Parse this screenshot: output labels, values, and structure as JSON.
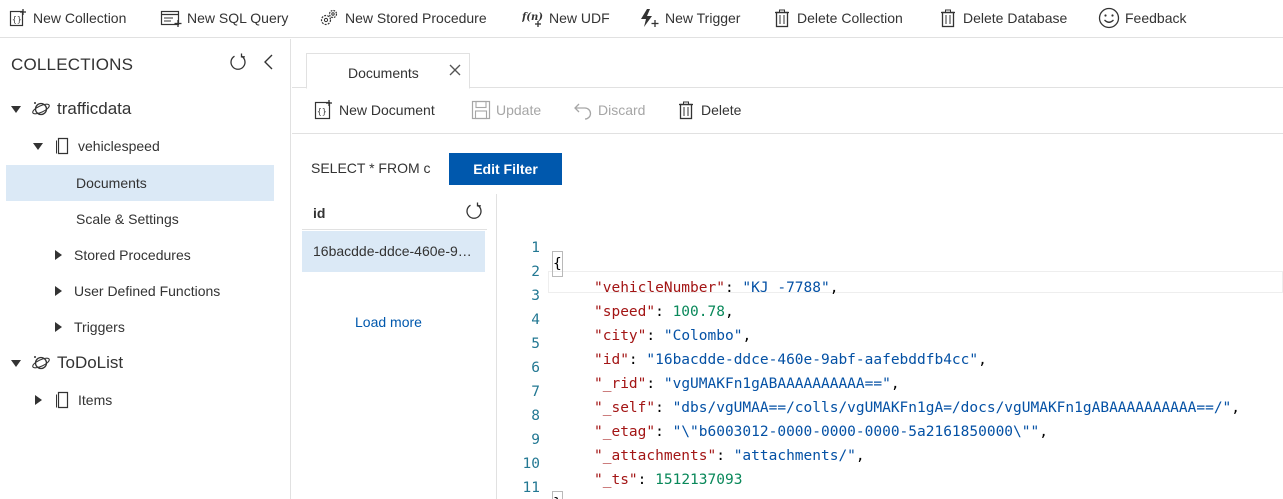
{
  "toolbar": {
    "new_collection": "New Collection",
    "new_sql_query": "New SQL Query",
    "new_stored_procedure": "New Stored Procedure",
    "new_udf": "New UDF",
    "new_trigger": "New Trigger",
    "delete_collection": "Delete Collection",
    "delete_database": "Delete Database",
    "feedback": "Feedback"
  },
  "sidebar": {
    "title": "COLLECTIONS",
    "tree": [
      {
        "label": "trafficdata",
        "level": "database",
        "expanded": true
      },
      {
        "label": "vehiclespeed",
        "level": "collection",
        "expanded": true
      },
      {
        "label": "Documents",
        "level": "child",
        "selected": true
      },
      {
        "label": "Scale & Settings",
        "level": "child"
      },
      {
        "label": "Stored Procedures",
        "level": "group"
      },
      {
        "label": "User Defined Functions",
        "level": "group"
      },
      {
        "label": "Triggers",
        "level": "group"
      },
      {
        "label": "ToDoList",
        "level": "database",
        "expanded": true
      },
      {
        "label": "Items",
        "level": "collection",
        "expanded": false
      }
    ]
  },
  "tab": {
    "label": "Documents"
  },
  "commands": {
    "new_document": "New Document",
    "update": "Update",
    "discard": "Discard",
    "delete": "Delete"
  },
  "filter": {
    "query": "SELECT * FROM c",
    "edit_button": "Edit Filter"
  },
  "id_list": {
    "header": "id",
    "rows": [
      "16bacdde-ddce-460e-9abf-aafebddfb4cc"
    ],
    "load_more": "Load more"
  },
  "document": {
    "line_numbers": [
      "1",
      "2",
      "3",
      "4",
      "5",
      "6",
      "7",
      "8",
      "9",
      "10",
      "11"
    ],
    "open_brace": "{",
    "close_brace": "}",
    "fields": [
      {
        "key": "\"vehicleNumber\"",
        "value": "\"KJ -7788\"",
        "type": "string",
        "comma": ","
      },
      {
        "key": "\"speed\"",
        "value": "100.78",
        "type": "number",
        "comma": ","
      },
      {
        "key": "\"city\"",
        "value": "\"Colombo\"",
        "type": "string",
        "comma": ","
      },
      {
        "key": "\"id\"",
        "value": "\"16bacdde-ddce-460e-9abf-aafebddfb4cc\"",
        "type": "string",
        "comma": ","
      },
      {
        "key": "\"_rid\"",
        "value": "\"vgUMAKFn1gABAAAAAAAAAA==\"",
        "type": "string",
        "comma": ","
      },
      {
        "key": "\"_self\"",
        "value": "\"dbs/vgUMAA==/colls/vgUMAKFn1gA=/docs/vgUMAKFn1gABAAAAAAAAAA==/\"",
        "type": "string",
        "comma": ","
      },
      {
        "key": "\"_etag\"",
        "value": "\"\\\"b6003012-0000-0000-0000-5a2161850000\\\"\"",
        "type": "string",
        "comma": ","
      },
      {
        "key": "\"_attachments\"",
        "value": "\"attachments/\"",
        "type": "string",
        "comma": ","
      },
      {
        "key": "\"_ts\"",
        "value": "1512137093",
        "type": "number",
        "comma": ""
      }
    ]
  },
  "colors": {
    "accent": "#0058ad",
    "selection": "#dbe9f6",
    "json_key": "#a31515",
    "json_string": "#0451a5",
    "json_number": "#09885a",
    "line_number": "#237893"
  }
}
